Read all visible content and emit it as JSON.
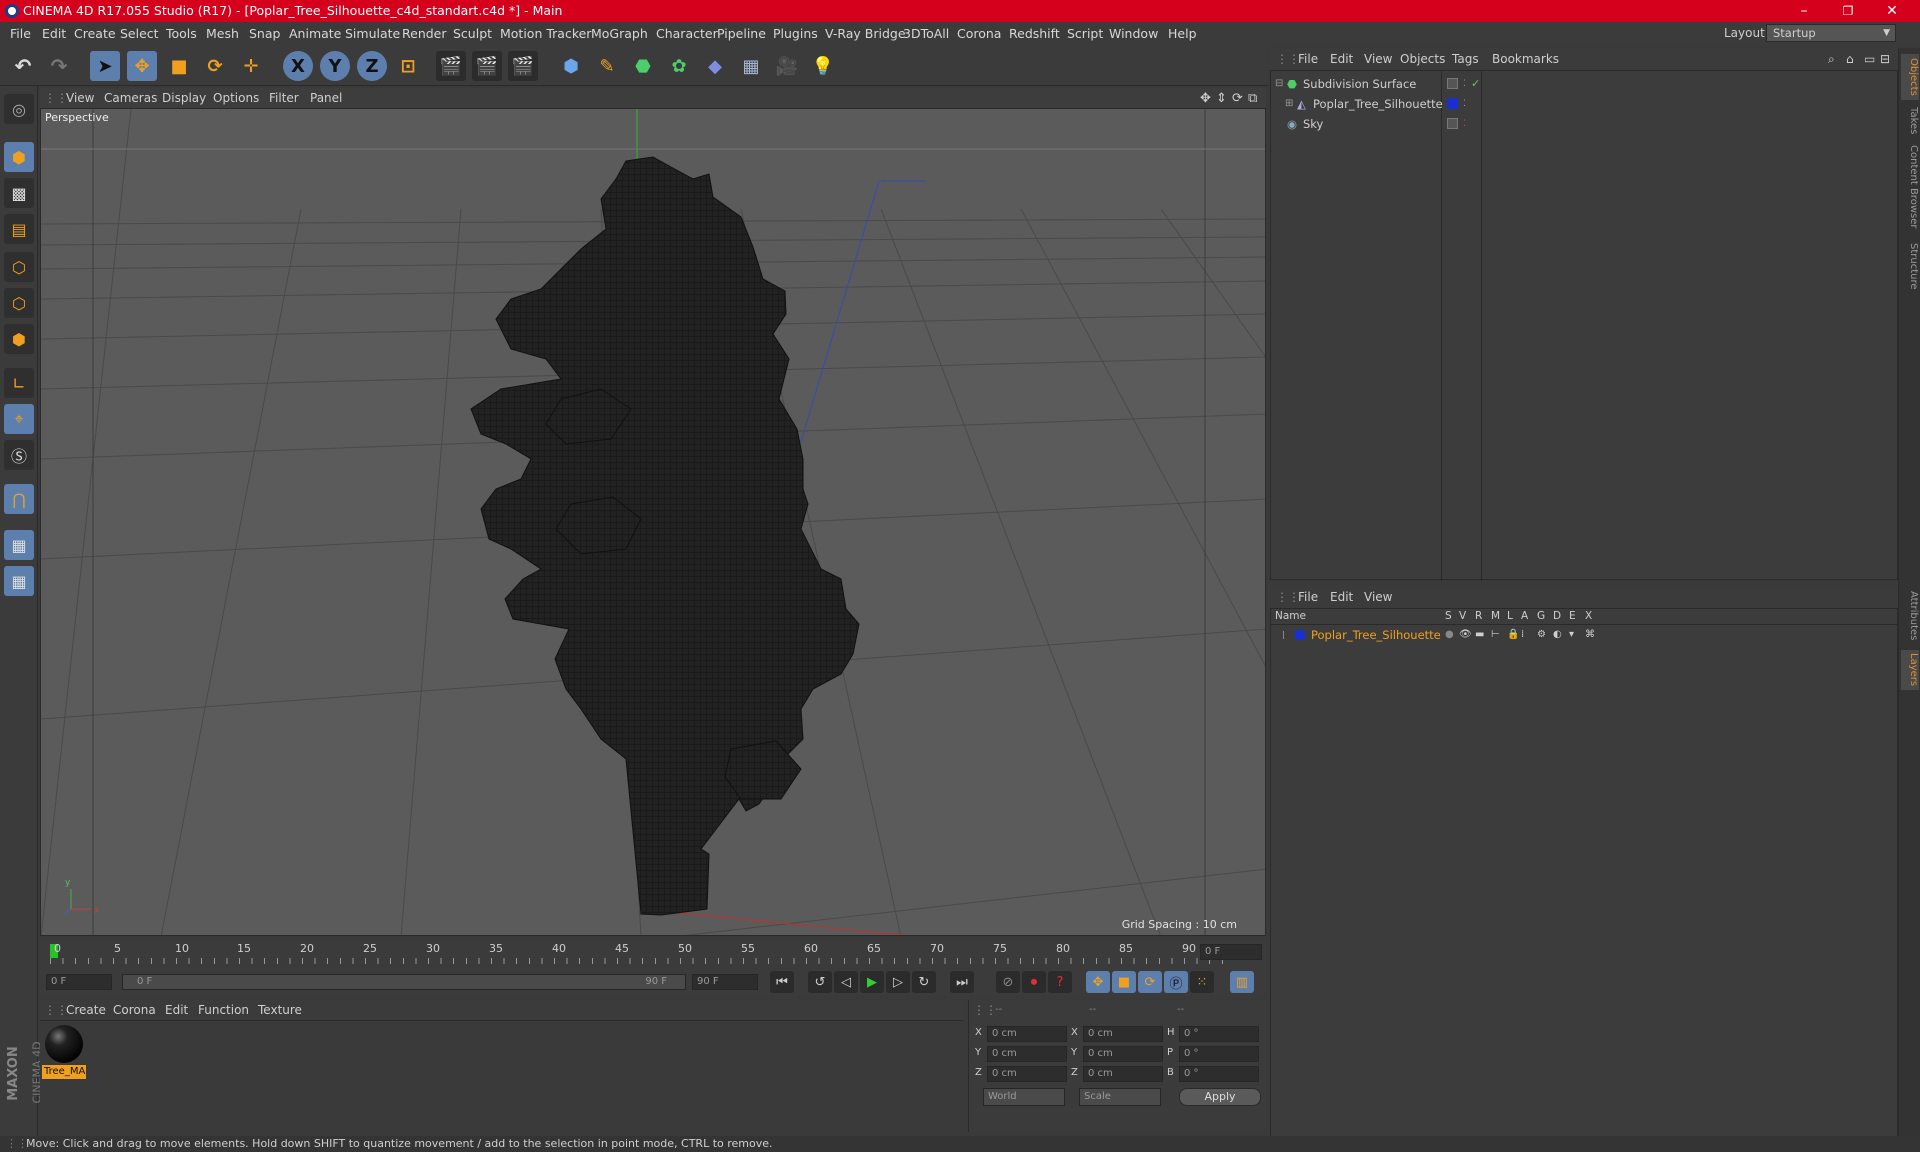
{
  "window": {
    "title": "CINEMA 4D R17.055 Studio (R17) - [Poplar_Tree_Silhouette_c4d_standart.c4d *] - Main",
    "minimize": "–",
    "maximize": "❐",
    "close": "✕"
  },
  "menubar": {
    "items": [
      "File",
      "Edit",
      "Create",
      "Select",
      "Tools",
      "Mesh",
      "Snap",
      "Animate",
      "Simulate",
      "Render",
      "Sculpt",
      "Motion Tracker",
      "MoGraph",
      "Character",
      "Pipeline",
      "Plugins",
      "V-Ray Bridge",
      "3DToAll",
      "Corona",
      "Redshift",
      "Script",
      "Window",
      "Help"
    ],
    "layout_label": "Layout:",
    "layout_value": "Startup"
  },
  "toolbar": {
    "x_label": "X",
    "y_label": "Y",
    "z_label": "Z"
  },
  "viewport": {
    "menu": [
      "View",
      "Cameras",
      "Display",
      "Options",
      "Filter",
      "Panel"
    ],
    "label": "Perspective",
    "grid_spacing": "Grid Spacing : 10 cm"
  },
  "timeline": {
    "ticks": [
      "0",
      "5",
      "10",
      "15",
      "20",
      "25",
      "30",
      "35",
      "40",
      "45",
      "50",
      "55",
      "60",
      "65",
      "70",
      "75",
      "80",
      "85",
      "90"
    ],
    "current_frame": "0 F",
    "start_field": "0 F",
    "range_start": "0 F",
    "range_end": "90 F",
    "end_field": "90 F"
  },
  "material_manager": {
    "menu": [
      "Create",
      "Corona",
      "Edit",
      "Function",
      "Texture"
    ],
    "materials": [
      {
        "name": "Tree_MA"
      }
    ]
  },
  "coordinates": {
    "headers": [
      "--",
      "--",
      "--"
    ],
    "rows": [
      {
        "a": "X",
        "av": "0 cm",
        "b": "X",
        "bv": "0 cm",
        "c": "H",
        "cv": "0 °"
      },
      {
        "a": "Y",
        "av": "0 cm",
        "b": "Y",
        "bv": "0 cm",
        "c": "P",
        "cv": "0 °"
      },
      {
        "a": "Z",
        "av": "0 cm",
        "b": "Z",
        "bv": "0 cm",
        "c": "B",
        "cv": "0 °"
      }
    ],
    "mode1": "World",
    "mode2": "Scale",
    "apply": "Apply"
  },
  "object_manager": {
    "menu": [
      "File",
      "Edit",
      "View",
      "Objects",
      "Tags",
      "Bookmarks"
    ],
    "objects": [
      {
        "name": "Subdivision Surface"
      },
      {
        "name": "Poplar_Tree_Silhouette"
      },
      {
        "name": "Sky"
      }
    ]
  },
  "layer_manager": {
    "menu": [
      "File",
      "Edit",
      "View"
    ],
    "columns": [
      "Name",
      "S",
      "V",
      "R",
      "M",
      "L",
      "A",
      "G",
      "D",
      "E",
      "X"
    ],
    "layers": [
      {
        "name": "Poplar_Tree_Silhouette",
        "color": "#1a2fd0"
      }
    ]
  },
  "right_dock": {
    "tabs": [
      "Objects",
      "Takes",
      "Content Browser",
      "Structure",
      "Attributes",
      "Layers"
    ]
  },
  "brand": {
    "maxon": "MAXON",
    "cinema": "CINEMA 4D"
  },
  "status": {
    "text": "Move: Click and drag to move elements. Hold down SHIFT to quantize movement / add to the selection in point mode, CTRL to remove."
  },
  "colors": {
    "title_bar": "#d4001c",
    "accent": "#5d7fae",
    "highlight": "#e09030",
    "layer_blue": "#1a2fd0"
  }
}
